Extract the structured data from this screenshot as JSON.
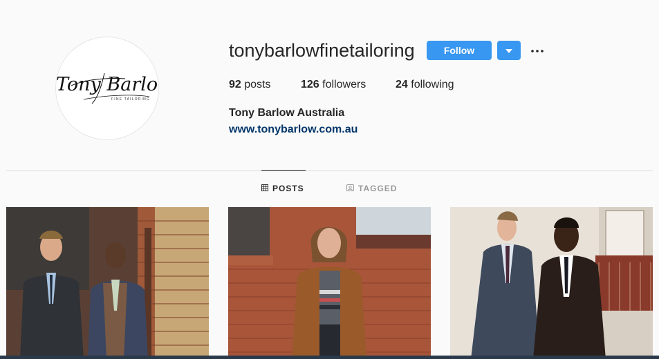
{
  "profile": {
    "username": "tonybarlowfinetailoring",
    "follow_label": "Follow",
    "full_name": "Tony Barlow Australia",
    "website": "www.tonybarlow.com.au",
    "logo_text": "Tony Barlow",
    "logo_sub": "FINE TAILORING"
  },
  "stats": {
    "posts_count": "92",
    "posts_label": "posts",
    "followers_count": "126",
    "followers_label": "followers",
    "following_count": "24",
    "following_label": "following"
  },
  "tabs": [
    {
      "label": "POSTS",
      "icon": "grid-icon",
      "active": true
    },
    {
      "label": "TAGGED",
      "icon": "tag-icon",
      "active": false
    }
  ],
  "posts": [
    {
      "icon": "photo-two-men-suits"
    },
    {
      "icon": "photo-man-suede-jacket"
    },
    {
      "icon": "photo-two-men-walking"
    }
  ],
  "colors": {
    "accent": "#3897f0",
    "link": "#003569",
    "background": "#fafafa"
  }
}
